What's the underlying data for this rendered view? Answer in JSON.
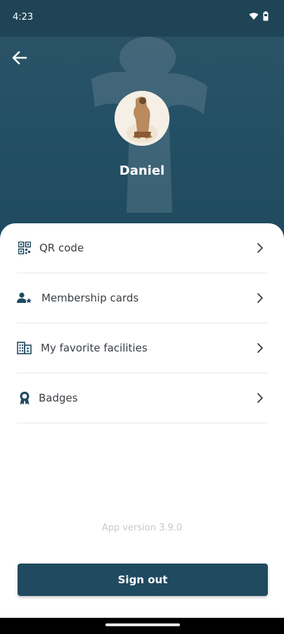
{
  "status_bar": {
    "time": "4:23",
    "icons": [
      "wifi-icon",
      "battery-icon"
    ]
  },
  "header": {
    "back_icon": "arrow-left-icon",
    "user_name": "Daniel",
    "background_color": "#245066"
  },
  "menu": {
    "items": [
      {
        "label": "QR code",
        "icon": "qr-code-icon"
      },
      {
        "label": "Membership cards",
        "icon": "member-star-icon"
      },
      {
        "label": "My favorite facilities",
        "icon": "building-icon"
      },
      {
        "label": "Badges",
        "icon": "badge-icon"
      }
    ],
    "chevron_icon": "chevron-right-icon"
  },
  "footer": {
    "app_version": "App version 3.9.0",
    "sign_out_label": "Sign out"
  },
  "colors": {
    "primary": "#1f4a60",
    "text": "#3a3f44",
    "muted": "#c5cace"
  }
}
